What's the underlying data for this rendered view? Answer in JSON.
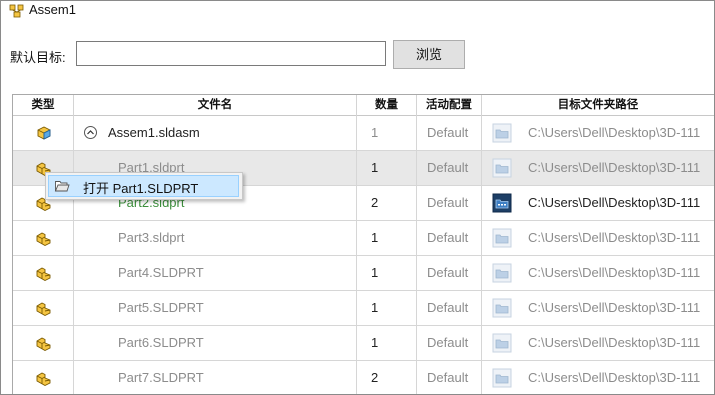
{
  "window": {
    "title": "Assem1"
  },
  "target": {
    "label": "默认目标:",
    "value": "",
    "browse_label": "浏览"
  },
  "columns": {
    "type": "类型",
    "name": "文件名",
    "qty": "数量",
    "config": "活动配置",
    "path": "目标文件夹路径"
  },
  "rows": [
    {
      "name": "Assem1.sldasm",
      "qty": "1",
      "config": "Default",
      "path": "C:\\Users\\Dell\\Desktop\\3D-111",
      "kind": "assembly"
    },
    {
      "name": "Part1.sldprt",
      "qty": "1",
      "config": "Default",
      "path": "C:\\Users\\Dell\\Desktop\\3D-111",
      "kind": "part"
    },
    {
      "name": "Part2.sldprt",
      "qty": "2",
      "config": "Default",
      "path": "C:\\Users\\Dell\\Desktop\\3D-111",
      "kind": "part"
    },
    {
      "name": "Part3.sldprt",
      "qty": "1",
      "config": "Default",
      "path": "C:\\Users\\Dell\\Desktop\\3D-111",
      "kind": "part"
    },
    {
      "name": "Part4.SLDPRT",
      "qty": "1",
      "config": "Default",
      "path": "C:\\Users\\Dell\\Desktop\\3D-111",
      "kind": "part"
    },
    {
      "name": "Part5.SLDPRT",
      "qty": "1",
      "config": "Default",
      "path": "C:\\Users\\Dell\\Desktop\\3D-111",
      "kind": "part"
    },
    {
      "name": "Part6.SLDPRT",
      "qty": "1",
      "config": "Default",
      "path": "C:\\Users\\Dell\\Desktop\\3D-111",
      "kind": "part"
    },
    {
      "name": "Part7.SLDPRT",
      "qty": "2",
      "config": "Default",
      "path": "C:\\Users\\Dell\\Desktop\\3D-111",
      "kind": "part"
    }
  ],
  "context_menu": {
    "item_label": "打开 Part1.SLDPRT",
    "icon": "open-folder-icon"
  },
  "colors": {
    "selected_row": "#e8e8e8",
    "menu_highlight": "#cce8ff",
    "green_text": "#3c8f3c",
    "muted_text": "#8c8c8c"
  }
}
